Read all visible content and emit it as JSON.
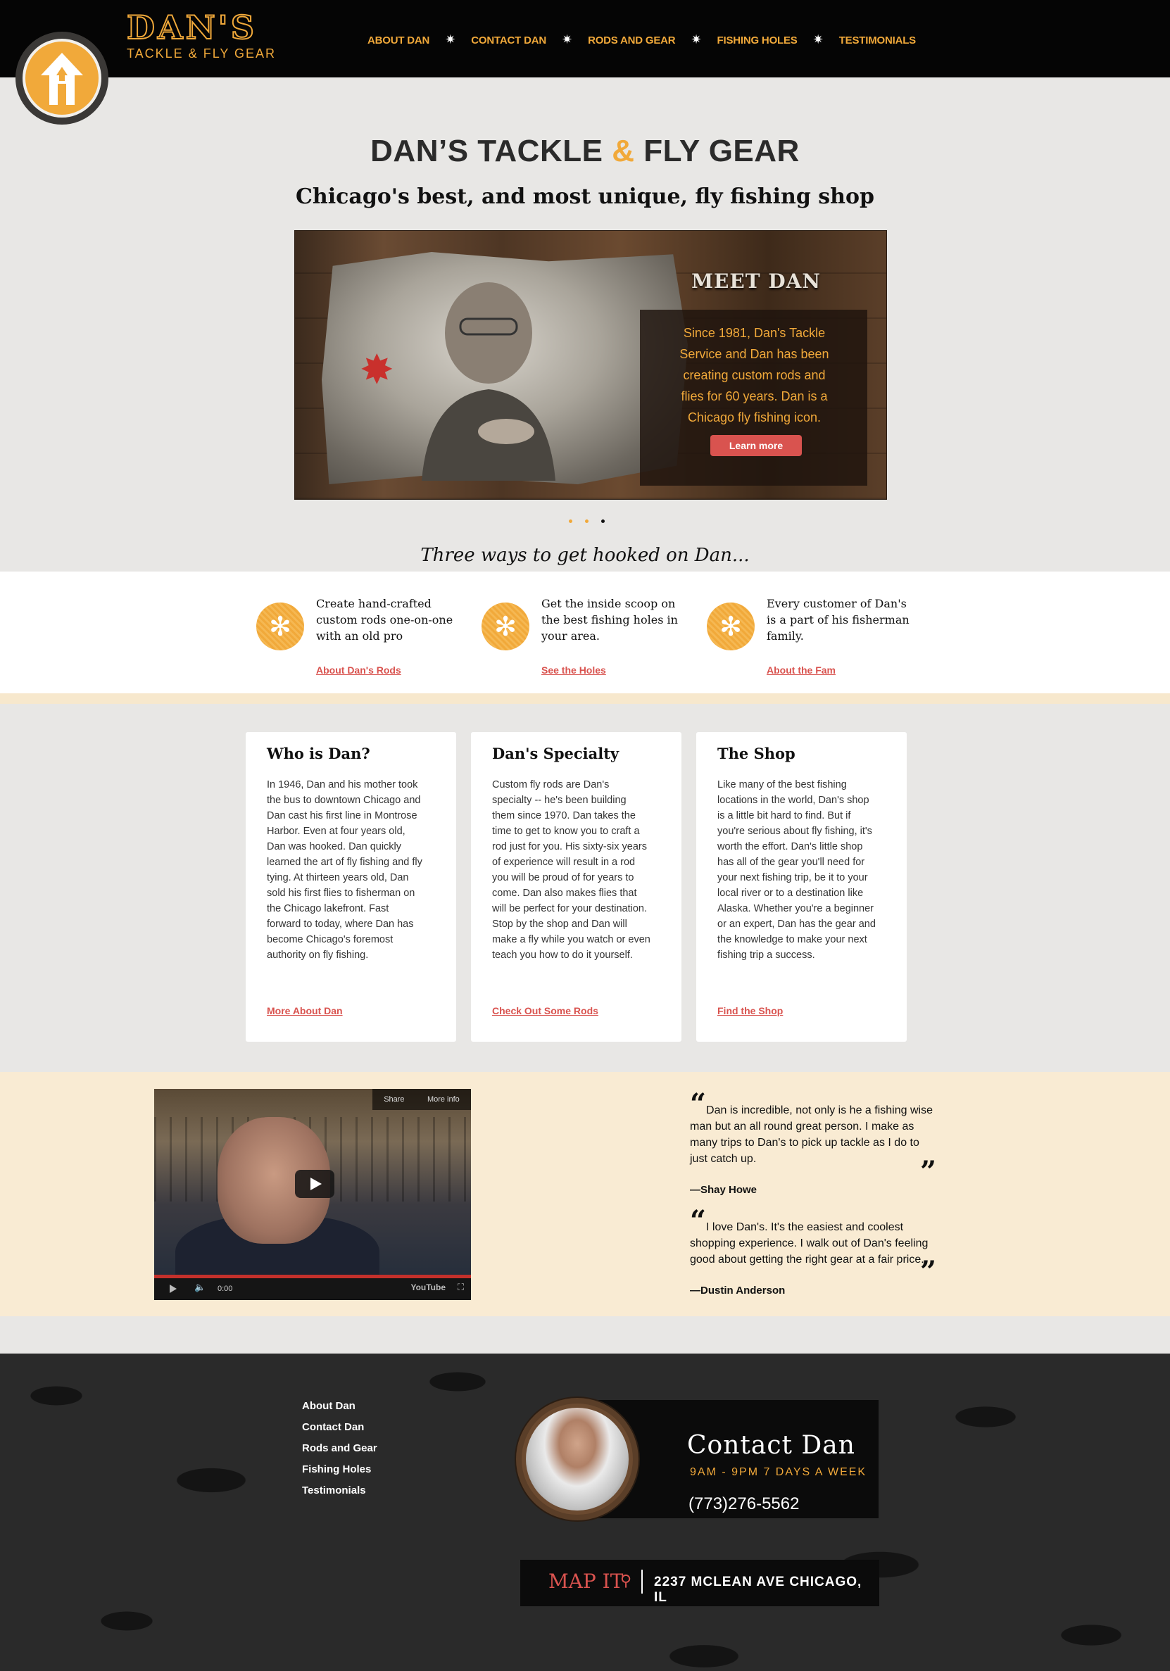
{
  "brand": {
    "name": "DAN'S",
    "tagline": "TACKLE & FLY GEAR"
  },
  "nav": {
    "items": [
      "ABOUT DAN",
      "CONTACT DAN",
      "RODS AND GEAR",
      "FISHING HOLES",
      "TESTIMONIALS"
    ],
    "separator_icon": "star-icon"
  },
  "hero": {
    "title_part1": "DAN’S TACKLE",
    "title_amp": "&",
    "title_part2": "FLY GEAR",
    "subtitle": "Chicago's best, and most unique, fly fishing shop"
  },
  "slide": {
    "heading": "MEET DAN",
    "text": "Since 1981,  Dan's Tackle Service and Dan has been creating custom rods and flies for 60 years.  Dan is a Chicago fly fishing icon.",
    "button": "Learn more",
    "dots_count": 3,
    "active_dot": 3
  },
  "ways": {
    "heading": "Three ways to get hooked on Dan...",
    "items": [
      {
        "text": "Create hand-crafted custom rods one-on-one with an old pro",
        "link": "About Dan's Rods",
        "icon": "asterisk-icon"
      },
      {
        "text": "Get the inside scoop on the best fishing holes in your area.",
        "link": "See the Holes",
        "icon": "asterisk-icon"
      },
      {
        "text": "Every customer of Dan's is a part of his fisherman family.",
        "link": "About the Fam",
        "icon": "asterisk-icon"
      }
    ]
  },
  "cards": [
    {
      "title": "Who is Dan?",
      "body": "In 1946, Dan and his mother took the bus to downtown Chicago and Dan cast his first line in Montrose Harbor. Even at four years old, Dan was hooked. Dan quickly learned the art of fly fishing and fly tying. At thirteen years old, Dan sold his first flies to fisherman on the Chicago lakefront. Fast forward to today, where Dan has become Chicago's foremost authority on fly fishing.",
      "link": "More About Dan"
    },
    {
      "title": "Dan's Specialty",
      "body": "Custom fly rods are Dan's specialty -- he's been building them since 1970. Dan takes the time to get to know you to craft a rod just for you. His sixty-six years of experience will result in a rod you will be proud of for years to come. Dan also makes flies that will be perfect for your destination. Stop by the shop and Dan will make a fly while you watch or even teach you how to do it yourself.",
      "link": "Check Out Some Rods"
    },
    {
      "title": "The Shop",
      "body": "Like many of the best fishing locations in the world, Dan's shop is a little bit hard to find. But if you're serious about fly fishing, it's worth the effort. Dan's little shop has all of the gear you'll need for your next fishing trip, be it to your local river or to a destination like Alaska. Whether you're a beginner or an expert, Dan has the gear and the knowledge to make your next fishing trip a success.",
      "link": "Find the Shop"
    }
  ],
  "video": {
    "share": "Share",
    "more_info": "More info",
    "time": "0:00",
    "provider": "YouTube"
  },
  "testimonials": [
    {
      "quote": "Dan is incredible, not only is he a fishing wise man but an all round great person. I make as many trips to Dan's to pick up tackle as I do to just catch up.",
      "author": "—Shay Howe"
    },
    {
      "quote": "I love Dan's. It's the easiest and coolest shopping experience. I walk out of Dan's feeling good about getting the right gear at a fair price.",
      "author": "—Dustin Anderson"
    }
  ],
  "footer": {
    "links": [
      "About Dan",
      "Contact Dan",
      "Rods and Gear",
      "Fishing Holes",
      "Testimonials"
    ],
    "contact_title": "Contact Dan",
    "hours": "9AM - 9PM 7 DAYS A WEEK",
    "phone": "(773)276-5562",
    "map_label": "MAP IT",
    "address": "2237 MCLEAN AVE CHICAGO, IL"
  },
  "colors": {
    "accent": "#f1a93a",
    "link": "#d9534f",
    "dark": "#050505",
    "cream": "#f9ebd3"
  }
}
